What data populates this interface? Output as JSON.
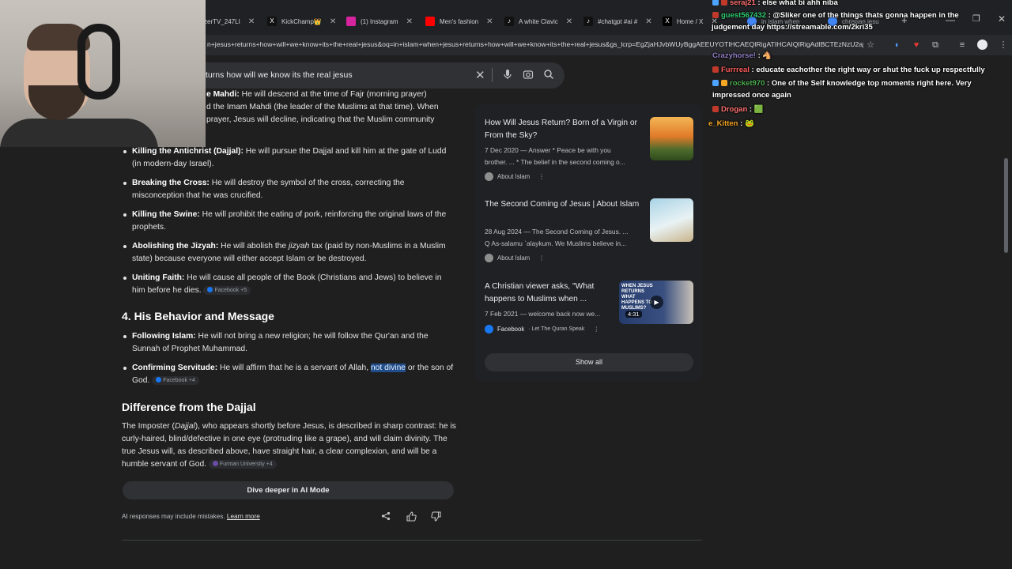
{
  "tabs": [
    {
      "label": "zerTV_247LI",
      "color": "#e53935"
    },
    {
      "label": "KickChamp👑",
      "color": "#2b2b2b"
    },
    {
      "label": "(1) Instagram",
      "color": "#d6249f"
    },
    {
      "label": "Men's fashion",
      "color": "#ff0000"
    },
    {
      "label": "A white Clavic",
      "color": "#111111"
    },
    {
      "label": "#chatgpt #ai #",
      "color": "#111111"
    },
    {
      "label": "Home / X",
      "color": "#000000"
    },
    {
      "label": "in islam when",
      "color": "#4285f4"
    },
    {
      "label": "christian jesu",
      "color": "#4285f4"
    }
  ],
  "address": {
    "url": "n+jesus+returns+how+will+we+know+its+the+real+jesus&oq=in+islam+when+jesus+returns+how+will+we+know+its+the+real+jesus&gs_lcrp=EgZjaHJvbWUyBggAEEUYOTIHCAEQIRigATIHCAIQIRigAdIBCTEzNzU2ajBqN6gCALACAA&sourceid=chrome&ie=UTF-8&udm=50&aep=11&ved=2ahUKEwj_5v_ZjYuLAxUDFVkFHX1TJCAEQIRgKGKABMgKl..."
  },
  "search": {
    "query": "turns how will we know its the real jesus"
  },
  "main": {
    "top_line1_bold": "e Mahdi:",
    "top_line1": " He will descend at the time of Fajr (morning prayer)",
    "top_line2": "d the Imam Mahdi (the leader of the Muslims at that time). When",
    "top_line3": "prayer, Jesus will decline, indicating that the Muslim community",
    "bullets1": [
      {
        "bold": "Killing the Antichrist (Dajjal):",
        "text": " He will pursue the Dajjal and kill him at the gate of Ludd (in modern-day Israel)."
      },
      {
        "bold": "Breaking the Cross:",
        "text": " He will destroy the symbol of the cross, correcting the misconception that he was crucified."
      },
      {
        "bold": "Killing the Swine:",
        "text": " He will prohibit the eating of pork, reinforcing the original laws of the prophets."
      },
      {
        "bold": "Abolishing the Jizyah:",
        "text_pre": " He will abolish the ",
        "italic": "jizyah",
        "text": " tax (paid by non-Muslims in a Muslim state) because everyone will either accept Islam or be destroyed."
      },
      {
        "bold": "Uniting Faith:",
        "text": " He will cause all people of the Book (Christians and Jews) to believe in him before he dies.",
        "source": "Facebook +5"
      }
    ],
    "heading4": "4. His Behavior and Message",
    "bullets2": [
      {
        "bold": "Following Islam:",
        "text": " He will not bring a new religion; he will follow the Qur'an and the Sunnah of Prophet Muhammad."
      },
      {
        "bold": "Confirming Servitude:",
        "text_pre": " He will affirm that he is a servant of Allah, ",
        "highlight": "not divine",
        "text": " or the son of God.",
        "source": "Facebook +4"
      }
    ],
    "heading_diff": "Difference from the Dajjal",
    "diff_pre": "The Imposter (",
    "diff_italic": "Dajjal",
    "diff_text": "), who appears shortly before Jesus, is described in sharp contrast: he is curly-haired, blind/defective in one eye (protruding like a grape), and will claim divinity. The true Jesus will, as described above, have straight hair, a clear complexion, and will be a humble servant of God.",
    "diff_source": "Furman University +4",
    "dive_label": "Dive deeper in AI Mode",
    "disclaimer": "AI responses may include mistakes.",
    "learn_more": "Learn more"
  },
  "panel": {
    "cards": [
      {
        "title": "How Will Jesus Return? Born of a Virgin or From the Sky?",
        "date": "7 Dec 2020 — Answer * Peace be with you",
        "snippet": "brother. ... * The belief in the second coming o...",
        "source": "About Islam",
        "thumb": "#d98a2b"
      },
      {
        "title": "The Second Coming of Jesus | About Islam",
        "date": "28 Aug 2024 — The Second Coming of Jesus. ...",
        "snippet": "Q As-salamu `alaykum. We Muslims believe in...",
        "source": "About Islam",
        "thumb": "#7fb2c9"
      },
      {
        "title": "A Christian viewer asks, \"What happens to Muslims when ...",
        "date": "7 Feb 2021 — welcome back now we...",
        "snippet": "",
        "source": "Facebook",
        "source_sub": "· Let The Quran Speak",
        "thumb": "#2a3a5c",
        "duration": "4:31",
        "thumb_text": "WHEN JESUS RETURNS WHAT HAPPENS TO MUSLIMS?"
      }
    ],
    "show_all": "Show all"
  },
  "chat": [
    {
      "user": "seraj21",
      "msg": "else what bi ahh niba",
      "color": "#ff6f6f"
    },
    {
      "user": "guest567432",
      "msg": "@Sliker one of the things thats gonna happen in the",
      "color": "#2ecc71"
    },
    {
      "user": "",
      "msg": "judgement day https://streamable.com/2kri35",
      "color": "#ffffff"
    },
    {
      "user": "Crazyhorse!",
      "msg": "",
      "color": "#8e7cc3"
    },
    {
      "user": "Furrreal",
      "msg": "educate eachother the right way or shut the fuck up respectfully",
      "color": "#ff5a5a"
    },
    {
      "user": "rocket970",
      "msg": "One of the Self knowledge top moments right here. Very",
      "color": "#4caf50"
    },
    {
      "user": "",
      "msg": "impressed once again",
      "color": "#ffffff"
    },
    {
      "user": "Drogan",
      "msg": "",
      "color": "#ff6f6f"
    },
    {
      "user": "e_Kitten",
      "msg": "",
      "color": "#f5a623"
    }
  ]
}
